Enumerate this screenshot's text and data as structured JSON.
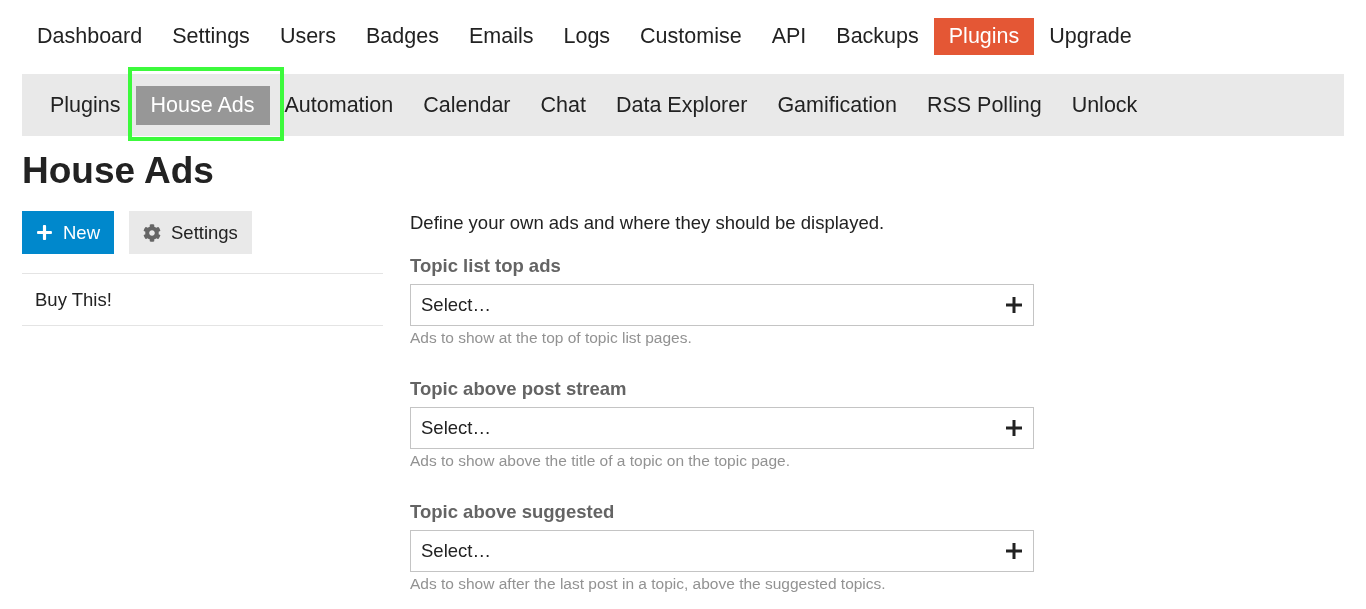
{
  "top_nav": [
    {
      "label": "Dashboard",
      "selected": false
    },
    {
      "label": "Settings",
      "selected": false
    },
    {
      "label": "Users",
      "selected": false
    },
    {
      "label": "Badges",
      "selected": false
    },
    {
      "label": "Emails",
      "selected": false
    },
    {
      "label": "Logs",
      "selected": false
    },
    {
      "label": "Customise",
      "selected": false
    },
    {
      "label": "API",
      "selected": false
    },
    {
      "label": "Backups",
      "selected": false
    },
    {
      "label": "Plugins",
      "selected": true
    },
    {
      "label": "Upgrade",
      "selected": false
    }
  ],
  "sub_nav": [
    {
      "label": "Plugins",
      "selected": false,
      "highlighted": false
    },
    {
      "label": "House Ads",
      "selected": true,
      "highlighted": true
    },
    {
      "label": "Automation",
      "selected": false,
      "highlighted": false
    },
    {
      "label": "Calendar",
      "selected": false,
      "highlighted": false
    },
    {
      "label": "Chat",
      "selected": false,
      "highlighted": false
    },
    {
      "label": "Data Explorer",
      "selected": false,
      "highlighted": false
    },
    {
      "label": "Gamification",
      "selected": false,
      "highlighted": false
    },
    {
      "label": "RSS Polling",
      "selected": false,
      "highlighted": false
    },
    {
      "label": "Unlock",
      "selected": false,
      "highlighted": false
    }
  ],
  "page_title": "House Ads",
  "actions": [
    {
      "label": "New",
      "kind": "primary"
    },
    {
      "label": "Settings",
      "kind": "secondary"
    }
  ],
  "ads": [
    "Buy This!"
  ],
  "intro": "Define your own ads and where they should be displayed.",
  "settings": [
    {
      "label": "Topic list top ads",
      "placeholder": "Select…",
      "help": "Ads to show at the top of topic list pages."
    },
    {
      "label": "Topic above post stream",
      "placeholder": "Select…",
      "help": "Ads to show above the title of a topic on the topic page."
    },
    {
      "label": "Topic above suggested",
      "placeholder": "Select…",
      "help": "Ads to show after the last post in a topic, above the suggested topics."
    }
  ]
}
